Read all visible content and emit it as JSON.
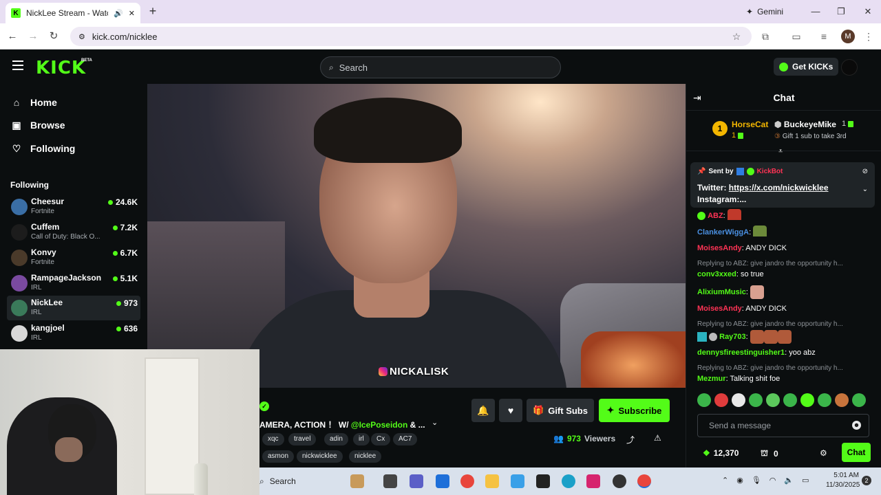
{
  "browser": {
    "tab_title": "NickLee Stream - Watch Liv",
    "new_tab": "+",
    "gemini": "Gemini",
    "url": "kick.com/nicklee",
    "profile_initial": "M",
    "win_min": "—",
    "win_max": "❐",
    "win_close": "✕"
  },
  "header": {
    "logo": "KICK",
    "beta": "BETA",
    "search_placeholder": "Search",
    "get_kicks": "Get KICKs"
  },
  "sidebar": {
    "nav": [
      {
        "label": "Home",
        "icon": "home-icon"
      },
      {
        "label": "Browse",
        "icon": "browse-icon"
      },
      {
        "label": "Following",
        "icon": "heart-icon"
      }
    ],
    "following_heading": "Following",
    "channels": [
      {
        "name": "Cheesur",
        "category": "Fortnite",
        "viewers": "24.6K",
        "color": "#3a6ea5"
      },
      {
        "name": "Cuffem",
        "category": "Call of Duty: Black O...",
        "viewers": "7.2K",
        "color": "#1c1c1c"
      },
      {
        "name": "Konvy",
        "category": "Fortnite",
        "viewers": "6.7K",
        "color": "#4a3a2a"
      },
      {
        "name": "RampageJackson",
        "category": "IRL",
        "viewers": "5.1K",
        "color": "#7a4aa0"
      },
      {
        "name": "NickLee",
        "category": "IRL",
        "viewers": "973",
        "color": "#3a7a5a"
      },
      {
        "name": "kangjoel",
        "category": "IRL",
        "viewers": "636",
        "color": "#d8d8d8"
      }
    ]
  },
  "video": {
    "overlay_handle": "NICKALISK"
  },
  "stream": {
    "title_prefix": "AMERA, ACTION ！ W/ ",
    "title_mention": "@IcePoseidon",
    "title_suffix": " & ...",
    "tags": [
      "xqc",
      "travel",
      "adin",
      "irl",
      "Cx",
      "AC7",
      "asmon",
      "nickwicklee",
      "nicklee"
    ],
    "gift_subs": "Gift Subs",
    "subscribe": "Subscribe",
    "viewers_count": "973",
    "viewers_label": "Viewers"
  },
  "chat": {
    "title": "Chat",
    "leader1_rank": "1",
    "leader1_name": "HorseCat",
    "leader1_count": "1",
    "leader2_name": "BuckeyeMike",
    "leader2_count": "1",
    "leader3_hint": "Gift 1 sub to take 3rd",
    "pinned_sent_by": "Sent by",
    "pinned_bot": "KickBot",
    "pinned_line1_label": "Twitter: ",
    "pinned_line1_link": "https://x.com/nickwicklee",
    "pinned_line2": "Instagram:...",
    "messages": [
      {
        "user": "ABZ",
        "color": "#ff3355",
        "text": ":",
        "emote": true
      },
      {
        "user": "ClankerWiggA",
        "color": "#4a90e2",
        "text": ":",
        "emote": true
      },
      {
        "user": "MoisesAndy",
        "color": "#ff3355",
        "text": ": ANDY DICK"
      },
      {
        "reply": "Replying to ABZ: give jandro the opportunity h..."
      },
      {
        "user": "conv3xxed",
        "color": "#53fc18",
        "text": ": so true"
      },
      {
        "user": "AlixiumMusic",
        "color": "#53fc18",
        "text": ":",
        "emote": true
      },
      {
        "user": "MoisesAndy",
        "color": "#ff3355",
        "text": ": ANDY DICK"
      },
      {
        "reply": "Replying to ABZ: give jandro the opportunity h..."
      },
      {
        "user": "Ray703",
        "color": "#53fc18",
        "text": ":",
        "emote": true
      },
      {
        "user": "dennysfireestinguisher1",
        "color": "#53fc18",
        "text": ": yoo abz"
      },
      {
        "reply": "Replying to ABZ: give jandro the opportunity h..."
      },
      {
        "user": "Mezmur",
        "color": "#53fc18",
        "text": ": Talking shit foe"
      }
    ],
    "input_placeholder": "Send a message",
    "kicks_balance": "12,370",
    "gift_balance": "0",
    "send_label": "Chat"
  },
  "taskbar": {
    "search": "Search",
    "time": "5:01 AM",
    "date": "11/30/2025",
    "notifications": "2"
  }
}
